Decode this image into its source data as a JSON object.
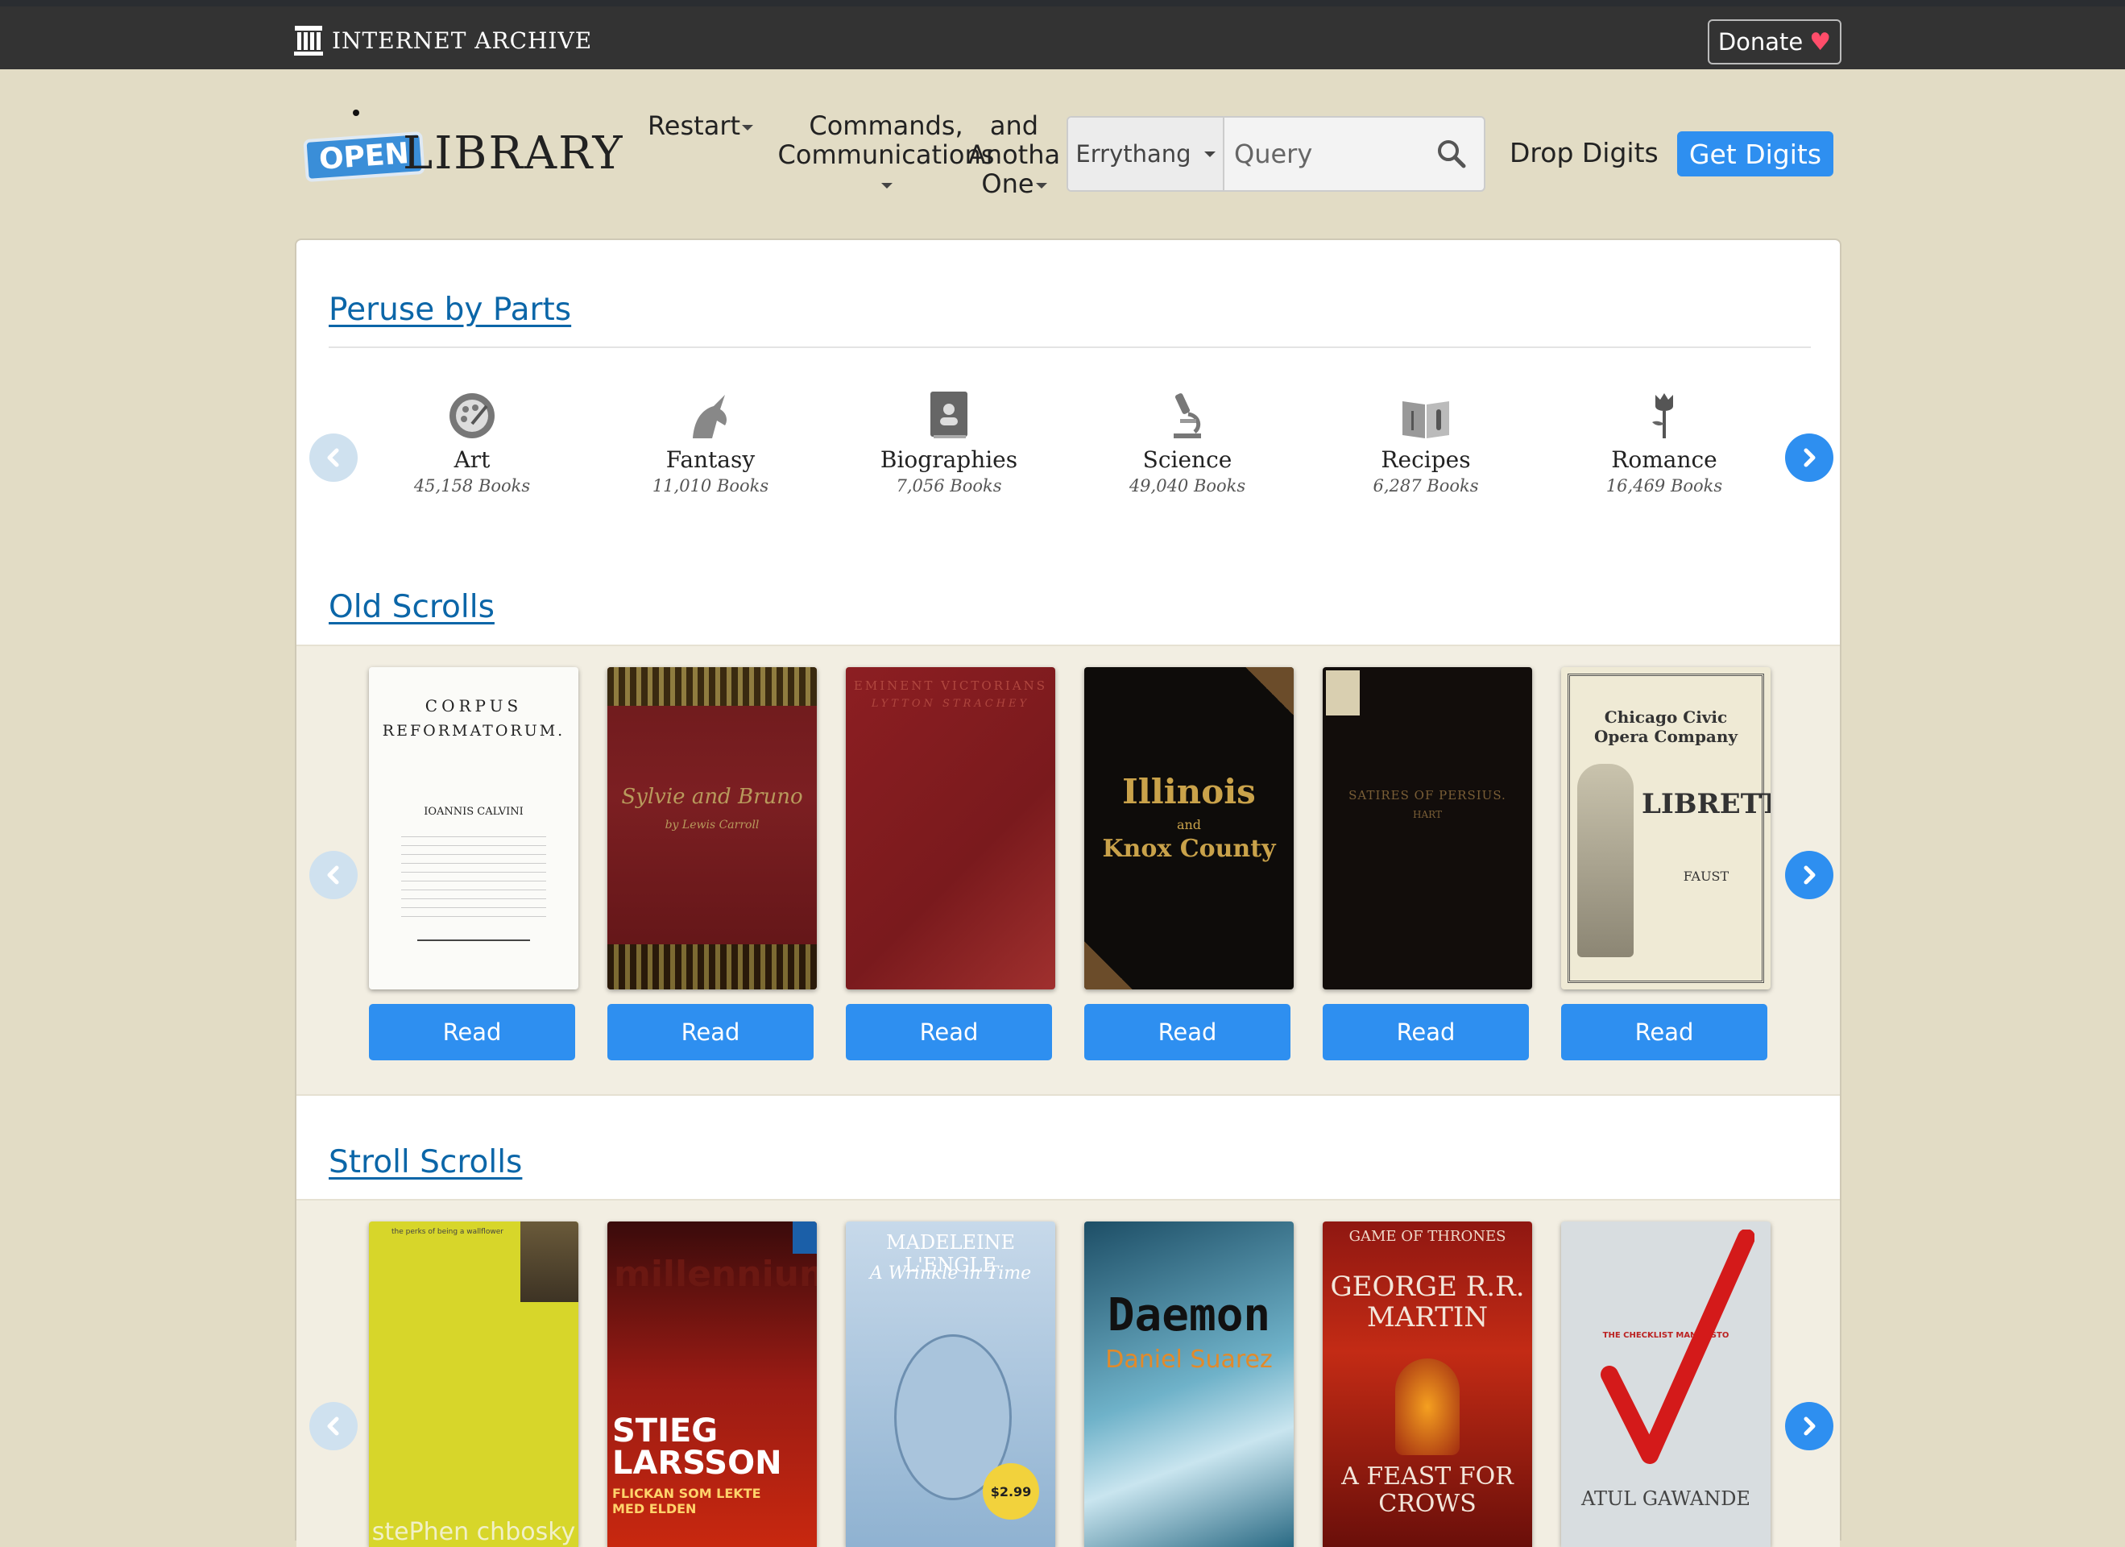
{
  "ia_bar": {
    "brand": "INTERNET ARCHIVE",
    "donate_label": "Donate",
    "donate_icon": "heart-icon"
  },
  "header": {
    "logo_open": "OPEN",
    "logo_library": "LIBRARY",
    "nav": {
      "restart": "Restart",
      "commands_line1": "Commands,",
      "commands_line2": "Communications",
      "anotha_line1": "and",
      "anotha_line2": "Anotha",
      "anotha_line3": "One"
    },
    "search": {
      "scope": "Errythang",
      "placeholder": "Query",
      "icon": "search-icon"
    },
    "drop_digits": "Drop Digits",
    "get_digits": "Get Digits"
  },
  "sections": {
    "subjects": {
      "title": "Peruse by Parts",
      "items": [
        {
          "name": "Art",
          "count": "45,158 Books",
          "icon": "palette-icon"
        },
        {
          "name": "Fantasy",
          "count": "11,010 Books",
          "icon": "unicorn-icon"
        },
        {
          "name": "Biographies",
          "count": "7,056 Books",
          "icon": "biography-book-icon"
        },
        {
          "name": "Science",
          "count": "49,040 Books",
          "icon": "microscope-icon"
        },
        {
          "name": "Recipes",
          "count": "6,287 Books",
          "icon": "recipe-book-icon"
        },
        {
          "name": "Romance",
          "count": "16,469 Books",
          "icon": "rose-icon"
        }
      ]
    },
    "old_scrolls": {
      "title": "Old Scrolls",
      "read_label": "Read",
      "covers": [
        {
          "line1": "CORPUS",
          "line2": "REFORMATORUM.",
          "line3": "IOANNIS CALVINI"
        },
        {
          "line1": "Sylvie and Bruno",
          "line2": "by Lewis Carroll"
        },
        {
          "line1": "EMINENT VICTORIANS",
          "line2": "LYTTON STRACHEY"
        },
        {
          "line1": "Illinois",
          "line2": "and",
          "line3": "Knox County"
        },
        {
          "line1": "SATIRES OF PERSIUS.",
          "line2": "HART"
        },
        {
          "line1": "Chicago Civic Opera Company",
          "line2": "LIBRETTO",
          "line3": "FAUST"
        }
      ]
    },
    "stroll_scrolls": {
      "title": "Stroll Scrolls",
      "covers": [
        {
          "line1": "the perks of being a wallflower",
          "line2": "stePhen chbosky"
        },
        {
          "line1": "millennium",
          "line2": "STIEG LARSSON",
          "line3": "FLICKAN SOM LEKTE MED ELDEN"
        },
        {
          "line1": "MADELEINE L'ENGLE",
          "line2": "A Wrinkle in Time",
          "line3": "$2.99"
        },
        {
          "line1": "Daemon",
          "line2": "Daniel Suarez"
        },
        {
          "line1": "GAME OF THRONES",
          "line2": "GEORGE R.R. MARTIN",
          "line3": "A FEAST FOR CROWS"
        },
        {
          "line1": "THE CHECKLIST MANIFESTO",
          "line2": "ATUL GAWANDE"
        }
      ]
    }
  },
  "colors": {
    "accent": "#2e8ff0",
    "link": "#0b66a8",
    "top_bar": "#333333",
    "page_bg": "#e2dcc5"
  }
}
